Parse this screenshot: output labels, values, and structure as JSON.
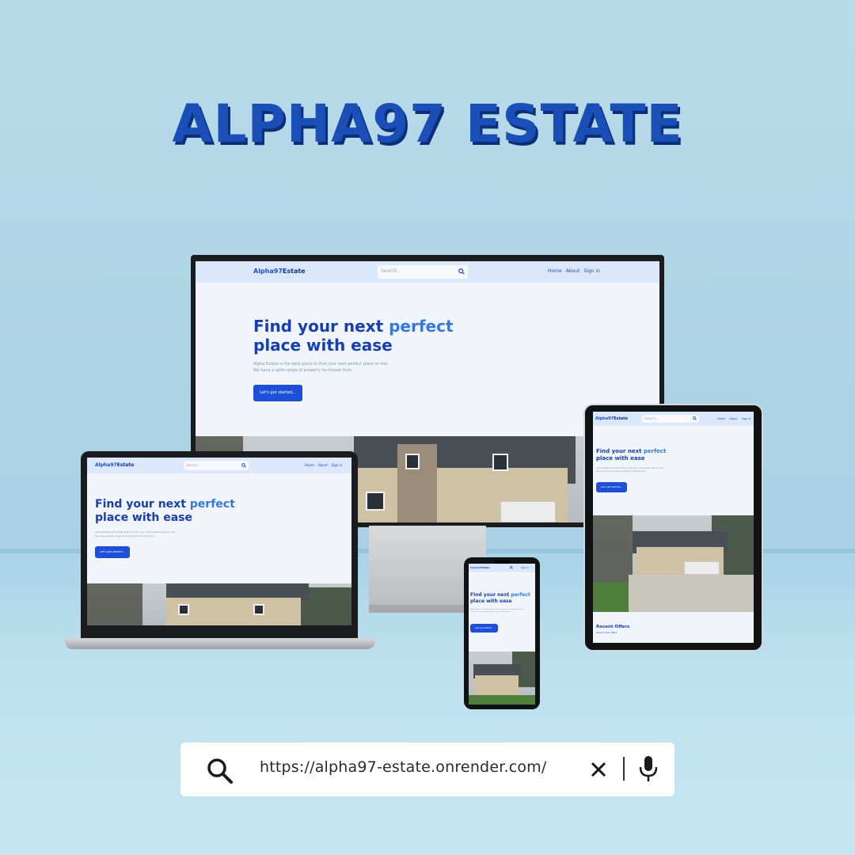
{
  "headline": "ALPHA97 ESTATE",
  "site": {
    "logo_light": "Alpha97",
    "logo_dark": "Estate",
    "search_placeholder": "Search...",
    "nav": [
      "Home",
      "About",
      "Sign in"
    ],
    "hero_title_a": "Find your next ",
    "hero_title_accent": "perfect",
    "hero_title_b": "place with ease",
    "hero_desc_1": "Alpha Estate is the best place to find your next perfect place to live.",
    "hero_desc_2": "We have a wide range of property to choose from.",
    "cta_label": "Let's get started...",
    "recent_offers": "Recent Offers",
    "show_more": "Show more offers"
  },
  "urlbar": {
    "url": "https://alpha97-estate.onrender.com/",
    "icons": [
      "search-icon",
      "close-icon",
      "microphone-icon"
    ]
  },
  "colors": {
    "primary": "#1d4fd8",
    "accent": "#3179e3",
    "header_bg": "#dbe8fb",
    "headline": "#1a4fb8"
  }
}
